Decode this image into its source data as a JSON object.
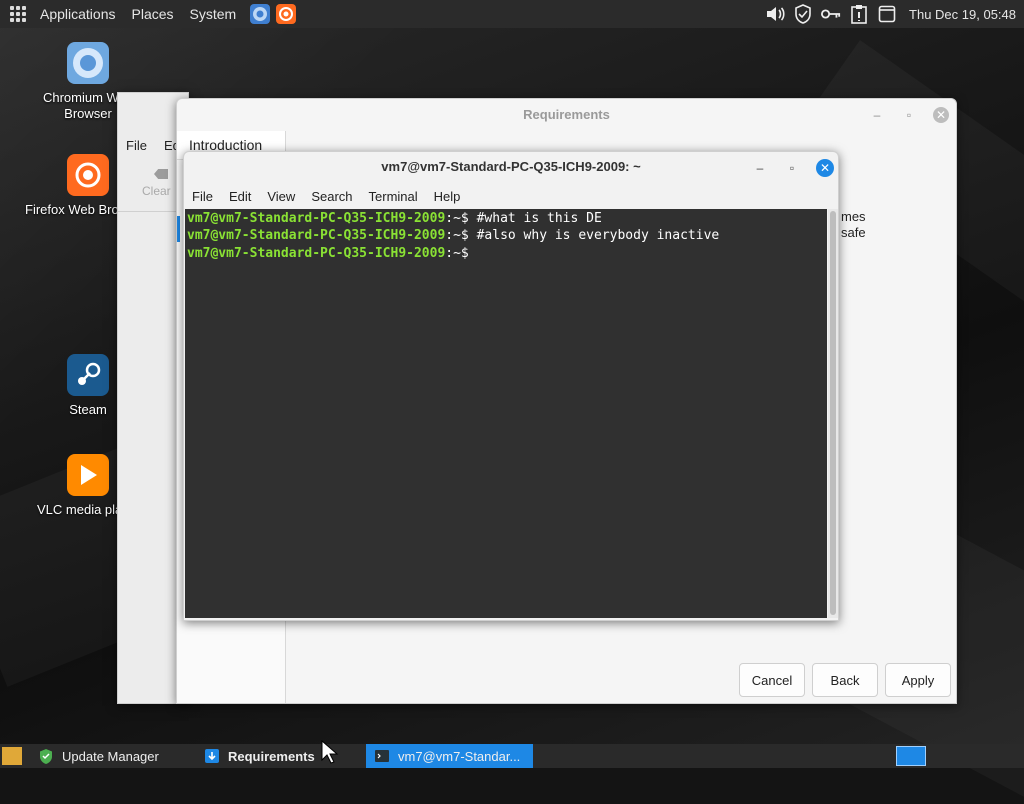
{
  "top_panel": {
    "menus": [
      "Applications",
      "Places",
      "System"
    ],
    "clock": "Thu Dec 19, 05:48",
    "launchers": [
      "chromium-icon",
      "firefox-icon"
    ],
    "tray_icons": [
      "volume-icon",
      "shield-icon",
      "key-icon",
      "clipboard-icon",
      "window-icon"
    ]
  },
  "desktop": {
    "icons": [
      {
        "label": "Chromium Web Browser",
        "icon": "chromium-icon",
        "color": "#7bb3e6"
      },
      {
        "label": "Firefox Web Bro",
        "icon": "firefox-icon",
        "color": "#ff6a1f"
      },
      {
        "label": "Steam",
        "icon": "steam-icon",
        "color": "#1b5a8f"
      },
      {
        "label": "VLC media pla",
        "icon": "vlc-icon",
        "color": "#ff8a00"
      }
    ]
  },
  "update_window": {
    "menu_file": "File",
    "menu_edit_partial": "Ed",
    "clear_label": "Clear"
  },
  "requirements_window": {
    "title": "Requirements",
    "tab_intro": "Introduction",
    "partial_right_1": "mes",
    "partial_right_2": "safe",
    "buttons": {
      "cancel": "Cancel",
      "back": "Back",
      "apply": "Apply"
    }
  },
  "terminal": {
    "title": "vm7@vm7-Standard-PC-Q35-ICH9-2009: ~",
    "menu": [
      "File",
      "Edit",
      "View",
      "Search",
      "Terminal",
      "Help"
    ],
    "lines": [
      {
        "user": "vm7@vm7-Standard-PC-Q35-ICH9-2009",
        "path": ":~$ ",
        "cmd": "#what is this DE"
      },
      {
        "user": "vm7@vm7-Standard-PC-Q35-ICH9-2009",
        "path": ":~$ ",
        "cmd": "#also why is everybody inactive"
      },
      {
        "user": "vm7@vm7-Standard-PC-Q35-ICH9-2009",
        "path": ":~$ ",
        "cmd": ""
      }
    ],
    "colors": {
      "prompt_user": "#8ae234",
      "background": "#303030"
    }
  },
  "taskbar": {
    "tasks": [
      {
        "label": "Update Manager",
        "icon": "shield-icon",
        "active": false
      },
      {
        "label": "Requirements",
        "icon": "download-icon",
        "active": false
      },
      {
        "label": "vm7@vm7-Standar...",
        "icon": "terminal-icon",
        "active": true
      }
    ]
  }
}
